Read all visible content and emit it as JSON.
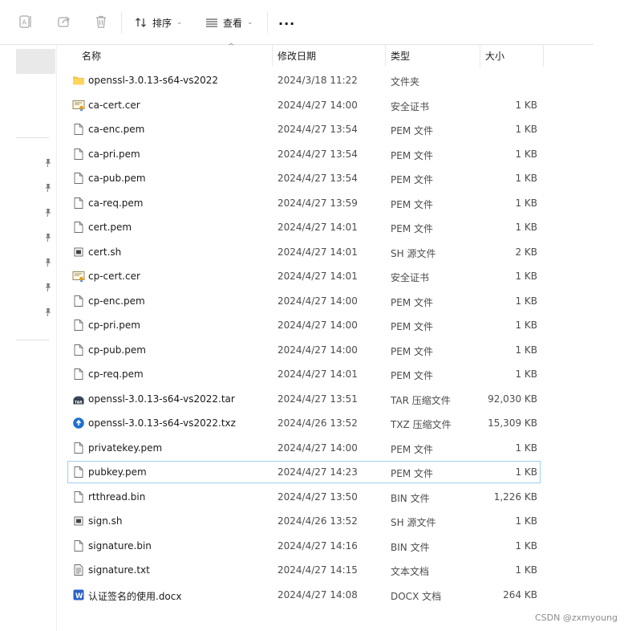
{
  "toolbar": {
    "sort_label": "排序",
    "view_label": "查看",
    "more_label": "···"
  },
  "columns": {
    "name": "名称",
    "date": "修改日期",
    "type": "类型",
    "size": "大小"
  },
  "files": [
    {
      "name": "openssl-3.0.13-s64-vs2022",
      "date": "2024/3/18 11:22",
      "type": "文件夹",
      "size": "",
      "icon": "folder-icon"
    },
    {
      "name": "ca-cert.cer",
      "date": "2024/4/27 14:00",
      "type": "安全证书",
      "size": "1 KB",
      "icon": "certificate-icon"
    },
    {
      "name": "ca-enc.pem",
      "date": "2024/4/27 13:54",
      "type": "PEM 文件",
      "size": "1 KB",
      "icon": "file-icon"
    },
    {
      "name": "ca-pri.pem",
      "date": "2024/4/27 13:54",
      "type": "PEM 文件",
      "size": "1 KB",
      "icon": "file-icon"
    },
    {
      "name": "ca-pub.pem",
      "date": "2024/4/27 13:54",
      "type": "PEM 文件",
      "size": "1 KB",
      "icon": "file-icon"
    },
    {
      "name": "ca-req.pem",
      "date": "2024/4/27 13:59",
      "type": "PEM 文件",
      "size": "1 KB",
      "icon": "file-icon"
    },
    {
      "name": "cert.pem",
      "date": "2024/4/27 14:01",
      "type": "PEM 文件",
      "size": "1 KB",
      "icon": "file-icon"
    },
    {
      "name": "cert.sh",
      "date": "2024/4/27 14:01",
      "type": "SH 源文件",
      "size": "2 KB",
      "icon": "script-icon"
    },
    {
      "name": "cp-cert.cer",
      "date": "2024/4/27 14:01",
      "type": "安全证书",
      "size": "1 KB",
      "icon": "certificate-icon"
    },
    {
      "name": "cp-enc.pem",
      "date": "2024/4/27 14:00",
      "type": "PEM 文件",
      "size": "1 KB",
      "icon": "file-icon"
    },
    {
      "name": "cp-pri.pem",
      "date": "2024/4/27 14:00",
      "type": "PEM 文件",
      "size": "1 KB",
      "icon": "file-icon"
    },
    {
      "name": "cp-pub.pem",
      "date": "2024/4/27 14:00",
      "type": "PEM 文件",
      "size": "1 KB",
      "icon": "file-icon"
    },
    {
      "name": "cp-req.pem",
      "date": "2024/4/27 14:01",
      "type": "PEM 文件",
      "size": "1 KB",
      "icon": "file-icon"
    },
    {
      "name": "openssl-3.0.13-s64-vs2022.tar",
      "date": "2024/4/27 13:51",
      "type": "TAR 压缩文件",
      "size": "92,030 KB",
      "icon": "tar-archive-icon"
    },
    {
      "name": "openssl-3.0.13-s64-vs2022.txz",
      "date": "2024/4/26 13:52",
      "type": "TXZ 压缩文件",
      "size": "15,309 KB",
      "icon": "txz-archive-icon"
    },
    {
      "name": "privatekey.pem",
      "date": "2024/4/27 14:00",
      "type": "PEM 文件",
      "size": "1 KB",
      "icon": "file-icon"
    },
    {
      "name": "pubkey.pem",
      "date": "2024/4/27 14:23",
      "type": "PEM 文件",
      "size": "1 KB",
      "icon": "file-icon",
      "selected": true
    },
    {
      "name": "rtthread.bin",
      "date": "2024/4/27 13:50",
      "type": "BIN 文件",
      "size": "1,226 KB",
      "icon": "file-icon"
    },
    {
      "name": "sign.sh",
      "date": "2024/4/26 13:52",
      "type": "SH 源文件",
      "size": "1 KB",
      "icon": "script-icon"
    },
    {
      "name": "signature.bin",
      "date": "2024/4/27 14:16",
      "type": "BIN 文件",
      "size": "1 KB",
      "icon": "file-icon"
    },
    {
      "name": "signature.txt",
      "date": "2024/4/27 14:15",
      "type": "文本文档",
      "size": "1 KB",
      "icon": "text-file-icon"
    },
    {
      "name": "认证签名的使用.docx",
      "date": "2024/4/27 14:08",
      "type": "DOCX 文档",
      "size": "264 KB",
      "icon": "word-doc-icon"
    }
  ],
  "watermark": "CSDN @zxmyoung"
}
